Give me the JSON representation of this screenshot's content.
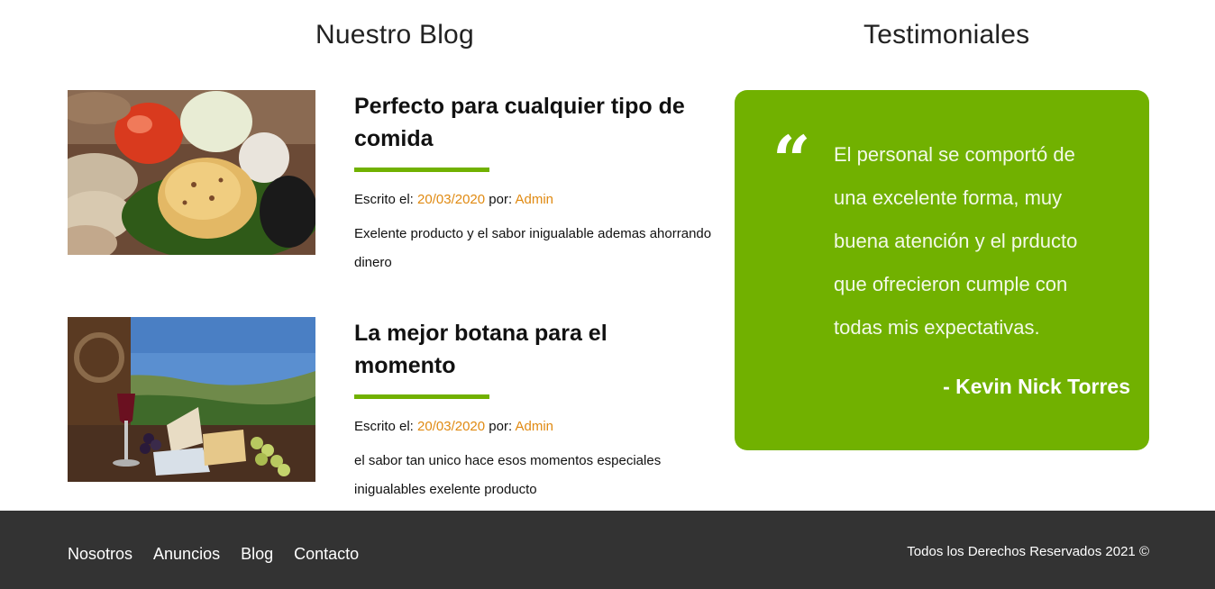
{
  "blog": {
    "title": "Nuestro Blog",
    "posts": [
      {
        "title": "Perfecto para cualquier tipo de comida",
        "written_label": "Escrito el:",
        "date": "20/03/2020",
        "by_label": "por:",
        "author": "Admin",
        "excerpt": "Exelente producto y el sabor inigualable ademas ahorrando dinero",
        "image": "cheese-bread-vegetables-photo"
      },
      {
        "title": "La mejor botana para el momento",
        "written_label": "Escrito el:",
        "date": "20/03/2020",
        "by_label": "por:",
        "author": "Admin",
        "excerpt": "el sabor tan unico hace esos momentos especiales inigualables exelente producto",
        "image": "cheese-wine-grapes-landscape-photo"
      }
    ]
  },
  "testimonials": {
    "title": "Testimoniales",
    "quote": "El personal se comportó de una excelente forma, muy buena atención y el prducto que ofrecieron cumple con todas mis expectativas.",
    "author": "- Kevin Nick Torres",
    "quote_icon": "quote-icon",
    "quote_mark": "“"
  },
  "footer": {
    "nav": [
      "Nosotros",
      "Anuncios",
      "Blog",
      "Contacto"
    ],
    "copyright": "Todos los Derechos Reservados 2021 ©"
  },
  "colors": {
    "accent_green": "#71b100",
    "accent_orange": "#e08a12",
    "footer_bg": "#333333"
  }
}
